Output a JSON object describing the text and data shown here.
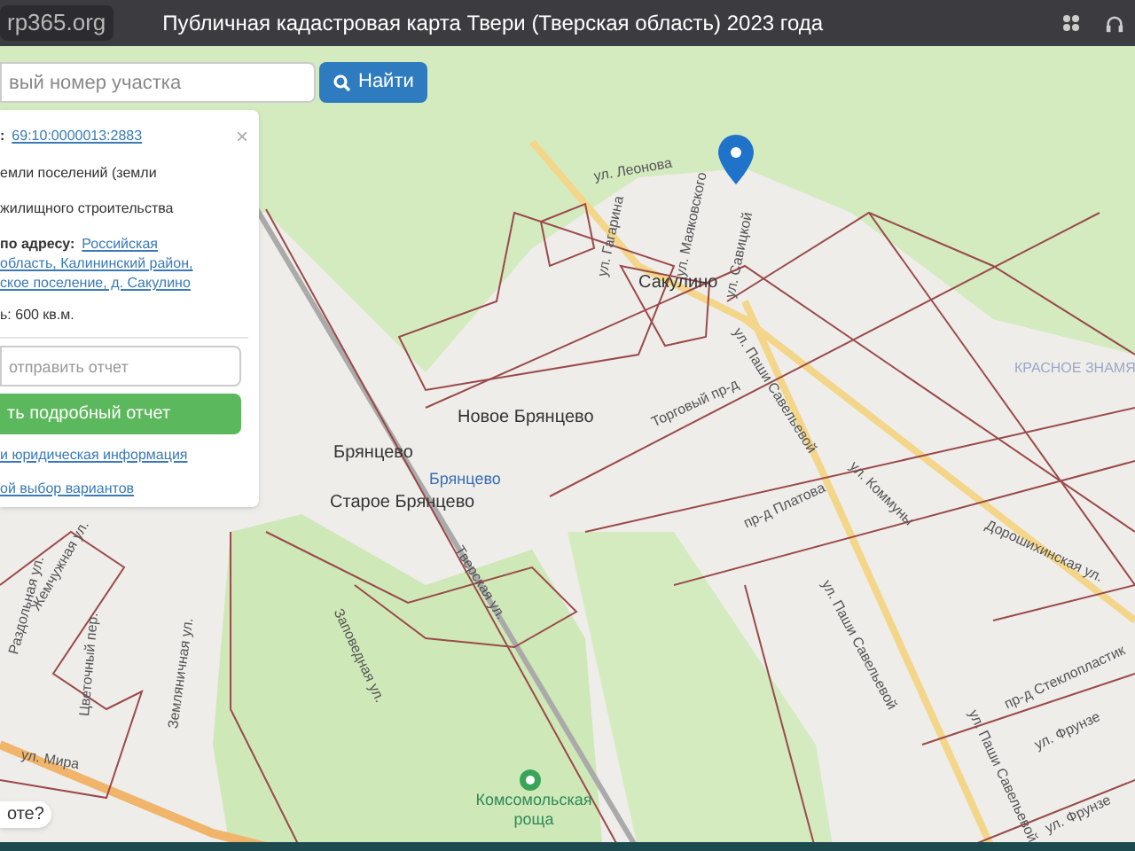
{
  "header": {
    "logo": "rp365.org",
    "title": "Публичная кадастровая карта Твери (Тверская область) 2023 года"
  },
  "search": {
    "placeholder": "вый номер участка",
    "button": "Найти"
  },
  "popup": {
    "close": "×",
    "number_label": ":",
    "number": "69:10:0000013:2883",
    "category": "емли поселений (земли",
    "use": "жилищного строительства",
    "address_label": "по адресу:",
    "address_lines": [
      "Российская",
      "область, Калининский район,",
      "ское поселение, д. Сакулино"
    ],
    "area": "ь: 600 кв.м.",
    "email_placeholder": "отправить отчет",
    "report_button": "ть подробный отчет",
    "links": [
      "и юридическая информация",
      "ой выбор вариантов"
    ]
  },
  "map_labels": [
    {
      "text": "ул. Леонова",
      "kind": "street"
    },
    {
      "text": "ул. Гагарина",
      "kind": "street"
    },
    {
      "text": "ул. Маяковского",
      "kind": "street"
    },
    {
      "text": "ул. Савицкой",
      "kind": "street"
    },
    {
      "text": "Сакулино",
      "kind": "village"
    },
    {
      "text": "ул. Паши Савельевой",
      "kind": "street"
    },
    {
      "text": "Новое Брянцево",
      "kind": "village"
    },
    {
      "text": "Брянцево",
      "kind": "village"
    },
    {
      "text": "Брянцево",
      "kind": "station"
    },
    {
      "text": "Старое Брянцево",
      "kind": "village"
    },
    {
      "text": "Торговый пр-д",
      "kind": "street"
    },
    {
      "text": "пр-д Платова",
      "kind": "street"
    },
    {
      "text": "ул. Коммуны",
      "kind": "street"
    },
    {
      "text": "КРАСНОЕ ЗНАМЯ",
      "kind": "district"
    },
    {
      "text": "ул. Паши Савельевой",
      "kind": "street"
    },
    {
      "text": "Дорошихинская ул.",
      "kind": "street"
    },
    {
      "text": "пр-д Стеклопластик",
      "kind": "street"
    },
    {
      "text": "ул. Фрунзе",
      "kind": "street"
    },
    {
      "text": "ул. Паши Савельевой",
      "kind": "street"
    },
    {
      "text": "ул. Фрунзе",
      "kind": "street"
    },
    {
      "text": "Тверская ул.",
      "kind": "street"
    },
    {
      "text": "Заповедная ул.",
      "kind": "street"
    },
    {
      "text": "Жемчужная ул.",
      "kind": "street"
    },
    {
      "text": "Раздольная ул.",
      "kind": "street"
    },
    {
      "text": "Цветочный пер.",
      "kind": "street"
    },
    {
      "text": "ул. Мира",
      "kind": "street"
    },
    {
      "text": "Земляничная ул.",
      "kind": "street"
    },
    {
      "text": "Комсомольская роща",
      "kind": "park"
    }
  ],
  "chat_bubble": "оте?"
}
